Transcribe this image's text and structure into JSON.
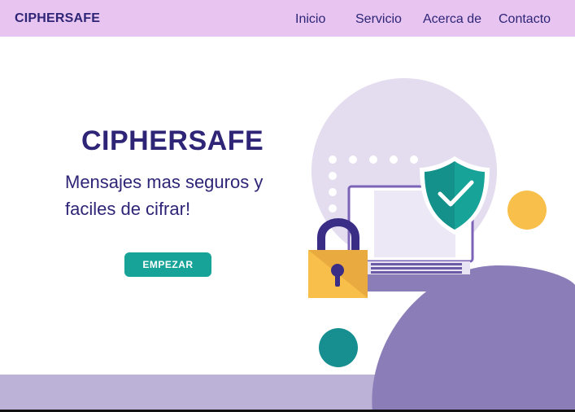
{
  "navbar": {
    "brand": "CIPHERSAFE",
    "links": [
      "Inicio",
      "Servicio",
      "Acerca de",
      "Contacto"
    ]
  },
  "hero": {
    "title": "CIPHERSAFE",
    "subtitle": "Mensajes mas seguros y faciles de cifrar!",
    "cta_label": "EMPEZAR"
  },
  "colors": {
    "navbar_bg": "#e8c4f0",
    "text_primary": "#2e2577",
    "accent_teal": "#17a398",
    "purple_blob": "#8b7db8",
    "lavender_circle": "#e4dcef",
    "yellow": "#f8c04a",
    "bottom_band": "#bcb1d6"
  },
  "icons": [
    "shield-check-icon",
    "padlock-icon",
    "laptop-icon"
  ]
}
